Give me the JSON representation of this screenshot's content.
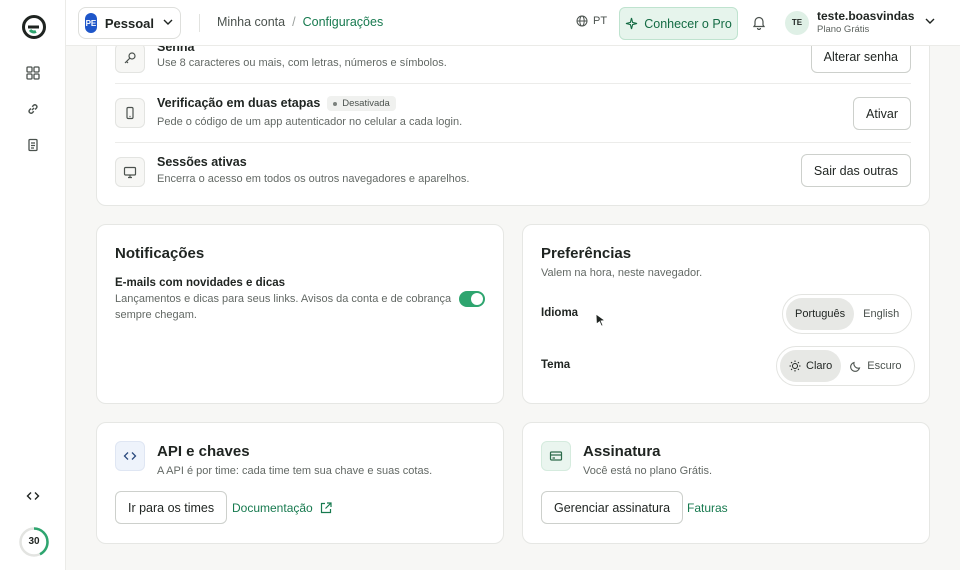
{
  "topbar": {
    "workspace_initials": "PE",
    "workspace_label": "Pessoal",
    "breadcrumb": [
      "Minha conta",
      "/",
      "Configurações"
    ],
    "language": "PT",
    "pro_label": "Conhecer o Pro",
    "user_initials": "TE",
    "user_name": "teste.boasvindas",
    "user_plan": "Plano Grátis"
  },
  "rail": {
    "credits": "30"
  },
  "security": {
    "rows": [
      {
        "title": "Senha",
        "desc": "Use 8 caracteres ou mais, com letras, números e símbolos.",
        "button": "Alterar senha",
        "icon": "key-icon"
      },
      {
        "title": "Verificação em duas etapas",
        "badge": "Desativada",
        "desc": "Pede o código de um app autenticador no celular a cada login.",
        "button": "Ativar",
        "icon": "phone-icon"
      },
      {
        "title": "Sessões ativas",
        "desc": "Encerra o acesso em todos os outros navegadores e aparelhos.",
        "button": "Sair das outras",
        "icon": "monitor-icon"
      }
    ]
  },
  "notifications": {
    "title": "Notificações",
    "item_title": "E-mails com novidades e dicas",
    "item_desc_1": "Lançamentos e dicas para seus links. Avisos da conta e de cobrança",
    "item_desc_2": "sempre chegam.",
    "enabled": true
  },
  "preferences": {
    "title": "Preferências",
    "subtitle": "Valem na hora, neste navegador.",
    "language_label": "Idioma",
    "language_options": [
      "Português",
      "English"
    ],
    "language_selected": "Português",
    "theme_label": "Tema",
    "theme_options": [
      "Claro",
      "Escuro"
    ],
    "theme_selected": "Claro"
  },
  "api": {
    "title": "API e chaves",
    "desc": "A API é por time: cada time tem sua chave e suas cotas.",
    "button": "Ir para os times",
    "link": "Documentação"
  },
  "subscription": {
    "title": "Assinatura",
    "desc": "Você está no plano Grátis.",
    "button": "Gerenciar assinatura",
    "link": "Faturas"
  },
  "colors": {
    "accent": "#2ea56f",
    "accent_text": "#177a4f",
    "workspace": "#1e56c9"
  }
}
